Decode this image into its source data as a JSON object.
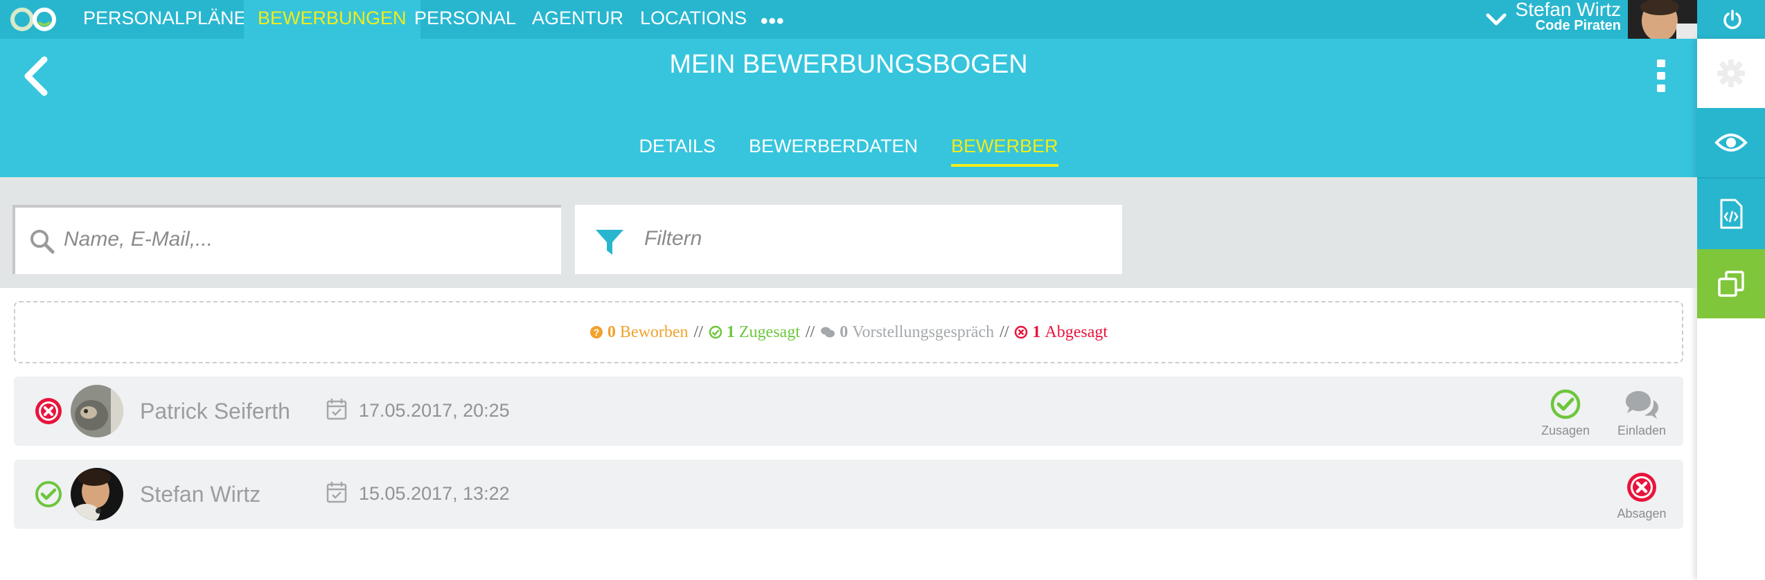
{
  "nav": {
    "items": [
      {
        "label": "PERSONALPLÄNE"
      },
      {
        "label": "BEWERBUNGEN"
      },
      {
        "label": "PERSONAL"
      },
      {
        "label": "AGENTUR"
      },
      {
        "label": "LOCATIONS"
      }
    ],
    "more_label": "•••",
    "active_index": 1
  },
  "user": {
    "name": "Stefan Wirtz",
    "company": "Code Piraten"
  },
  "header": {
    "title": "MEIN BEWERBUNGSBOGEN",
    "tabs": [
      {
        "label": "DETAILS"
      },
      {
        "label": "BEWERBERDATEN"
      },
      {
        "label": "BEWERBER"
      }
    ],
    "active_tab": 2
  },
  "search": {
    "placeholder": "Name, E-Mail,...",
    "filter_label": "Filtern"
  },
  "summary": {
    "beworben": {
      "count": "0",
      "label": "Beworben"
    },
    "zugesagt": {
      "count": "1",
      "label": "Zugesagt"
    },
    "vorstellung": {
      "count": "0",
      "label": "Vorstellungsgespräch"
    },
    "abgesagt": {
      "count": "1",
      "label": "Abgesagt"
    },
    "separator": "//"
  },
  "applicants": [
    {
      "name": "Patrick Seiferth",
      "date": "17.05.2017, 20:25",
      "status": "abgesagt",
      "actions": [
        {
          "label": "Zusagen"
        },
        {
          "label": "Einladen"
        }
      ]
    },
    {
      "name": "Stefan Wirtz",
      "date": "15.05.2017, 13:22",
      "status": "zugesagt",
      "actions": [
        {
          "label": "Absagen"
        }
      ]
    }
  ],
  "colors": {
    "primary": "#28b6cf",
    "header": "#36c5dd",
    "active_text": "#f3ec19",
    "green": "#6dc63b",
    "red": "#e8143c",
    "orange": "#f0a22d",
    "sidebar_green": "#7fc63a"
  },
  "icons": {
    "logo": "infinity-logo-icon",
    "back": "chevron-left-icon",
    "kebab": "vertical-dots-icon",
    "search": "search-icon",
    "filter": "filter-icon",
    "calendar": "calendar-check-icon",
    "sidebar": [
      "gear-icon",
      "eye-icon",
      "code-file-icon",
      "copy-icon"
    ]
  }
}
